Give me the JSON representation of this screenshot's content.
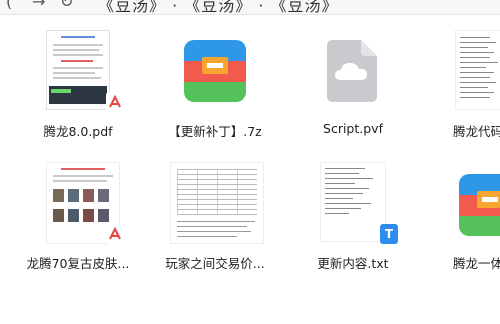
{
  "topbar": {
    "back_glyph": "(",
    "forward_glyph": "→",
    "refresh_glyph": "↻",
    "path_text": "《豆汤》 · 《豆汤》 · 《豆汤》"
  },
  "files": [
    {
      "name": "腾龙8.0.pdf",
      "type": "pdf",
      "icon": "pdf-document-icon"
    },
    {
      "name": "【更新补丁】.7z",
      "type": "7z",
      "icon": "archive-icon"
    },
    {
      "name": "Script.pvf",
      "type": "pvf",
      "icon": "cloud-file-icon"
    },
    {
      "name": "腾龙代码",
      "type": "txt",
      "icon": "text-document-icon"
    },
    {
      "name": "龙腾70复古皮肤...",
      "type": "pdf",
      "icon": "pdf-document-icon"
    },
    {
      "name": "玩家之间交易价...",
      "type": "doc",
      "icon": "document-icon"
    },
    {
      "name": "更新内容.txt",
      "type": "txt",
      "icon": "text-document-icon"
    },
    {
      "name": "腾龙一体",
      "type": "7z",
      "icon": "archive-icon"
    }
  ],
  "colors": {
    "pdf_red": "#e8473f",
    "archive_blue": "#2e97e6",
    "archive_red": "#f25a4e",
    "archive_orange": "#f7a531",
    "archive_green": "#55c15b",
    "cloud_gray": "#c8cace",
    "txt_badge_blue": "#2d8cf0"
  }
}
